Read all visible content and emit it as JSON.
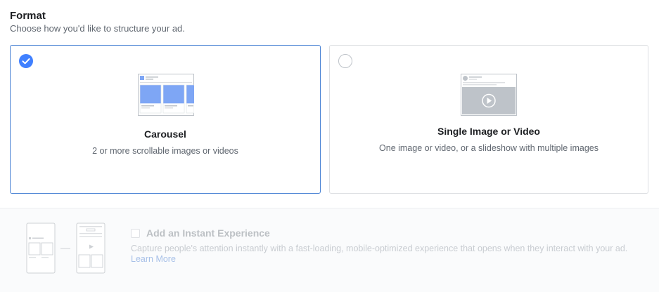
{
  "format": {
    "title": "Format",
    "subtitle": "Choose how you'd like to structure your ad."
  },
  "options": [
    {
      "title": "Carousel",
      "description": "2 or more scrollable images or videos",
      "selected": true,
      "illustration": "carousel-icon"
    },
    {
      "title": "Single Image or Video",
      "description": "One image or video, or a slideshow with multiple images",
      "selected": false,
      "illustration": "single-image-video-icon"
    }
  ],
  "instant_experience": {
    "title": "Add an Instant Experience",
    "description": "Capture people's attention instantly with a fast-loading, mobile-optimized experience that opens when they interact with your ad.",
    "link": "Learn More",
    "checked": false,
    "illustration": "instant-experience-icon"
  },
  "colors": {
    "accent": "#4080ff",
    "selected_border": "#4a83d4",
    "card_border": "#dddfe2",
    "muted_text": "#606770"
  }
}
